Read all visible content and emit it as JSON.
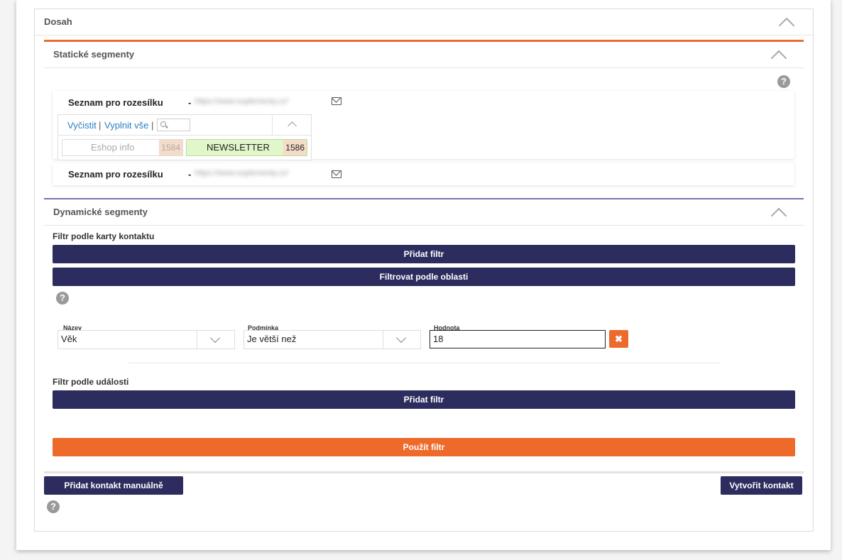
{
  "dosah": {
    "title": "Dosah"
  },
  "static_segments": {
    "title": "Statické segmenty",
    "lists": [
      {
        "name": "Seznam pro rozesílku",
        "dash": "-",
        "url": "https://www.suplementy.cz/"
      },
      {
        "name": "Seznam pro rozesílku",
        "dash": "-",
        "url": "https://www.suplementy.cz/"
      }
    ],
    "selector": {
      "clear_label": "Vyčistit",
      "fill_all_label": "Vyplnit vše",
      "separator": "|",
      "items": [
        {
          "label": "Eshop info",
          "count": "1584",
          "selected": false
        },
        {
          "label": "NEWSLETTER",
          "count": "1586",
          "selected": true
        }
      ]
    }
  },
  "dynamic_segments": {
    "title": "Dynamické segmenty",
    "contact_filter": {
      "label": "Filtr podle karty kontaktu",
      "add_filter": "Přidat filtr",
      "filter_by_area": "Filtrovat podle oblasti",
      "row": {
        "name_label": "Název",
        "name_value": "Věk",
        "condition_label": "Podmínka",
        "condition_value": "Je větší než",
        "value_label": "Hodnota",
        "value_value": "18",
        "delete_icon": "✖"
      }
    },
    "event_filter": {
      "label": "Filtr podle události",
      "add_filter": "Přidat filtr"
    },
    "apply_filter": "Použít filtr"
  },
  "footer": {
    "add_contact_manual": "Přidat kontakt manuálně",
    "create_contact": "Vytvořit kontakt"
  },
  "colors": {
    "accent_orange": "#ee6a2b",
    "button_navy": "#2c2c5e",
    "link_blue": "#2e7fc0",
    "selected_green": "#e2f7c9"
  },
  "icons": {
    "help": "?",
    "collapse": "chevron-up-icon",
    "envelope": "envelope-open-icon",
    "search": "search-icon"
  }
}
